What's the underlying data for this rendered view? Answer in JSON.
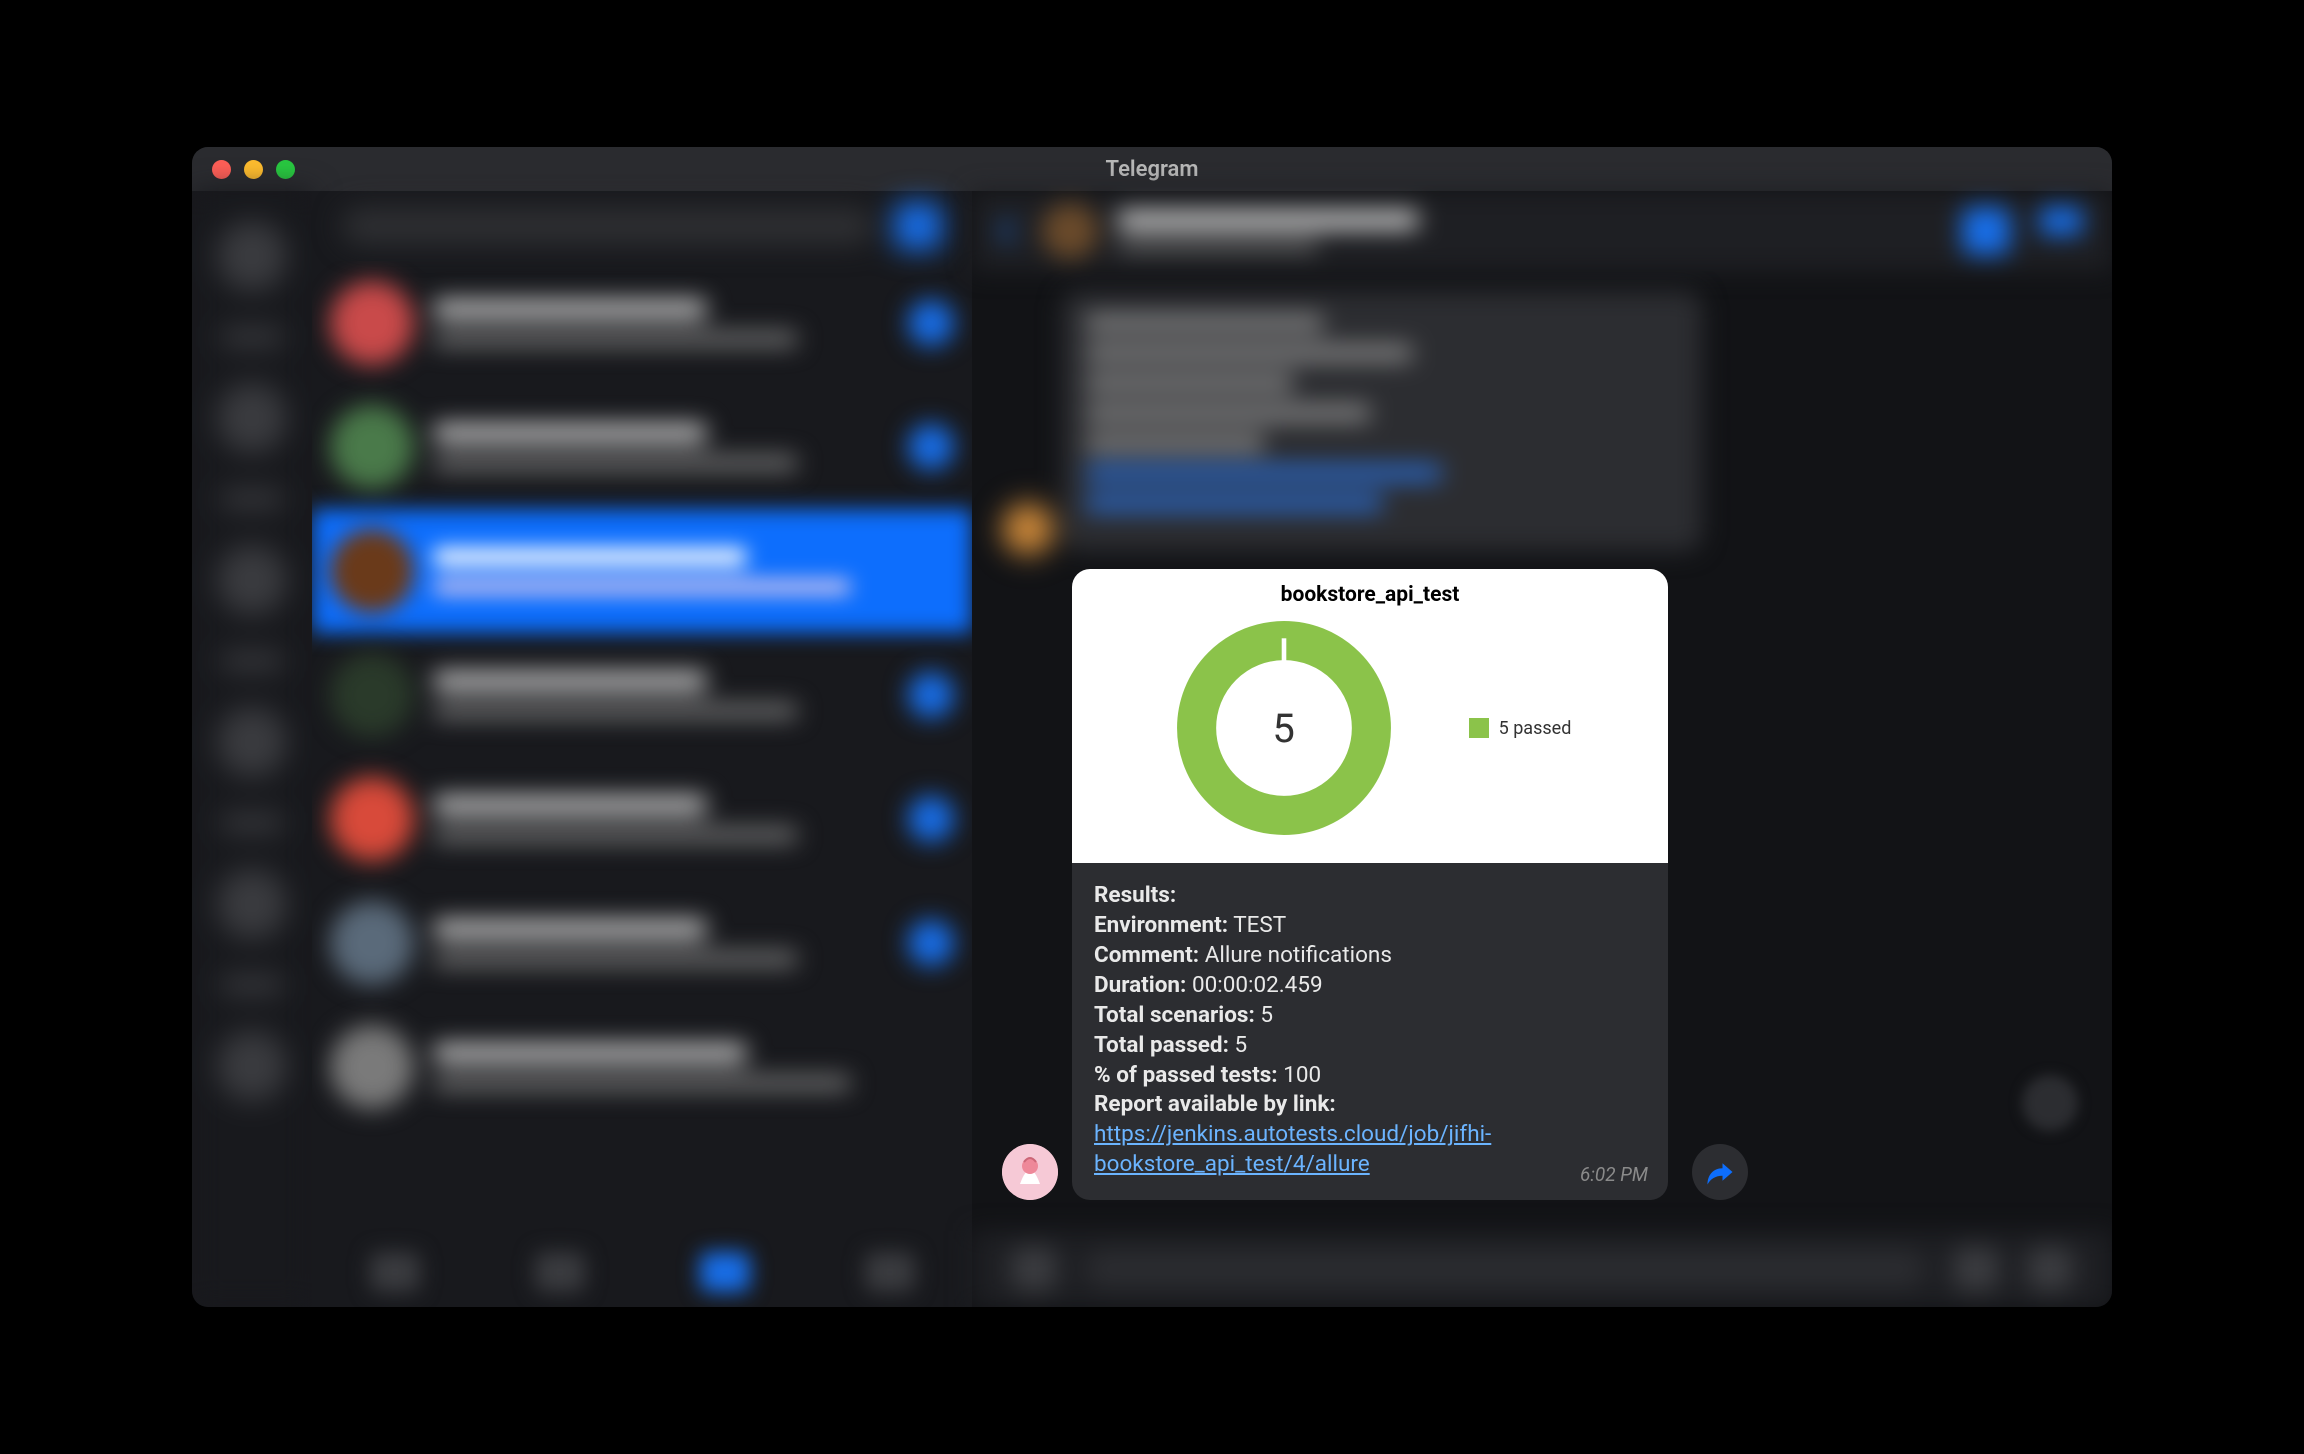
{
  "window": {
    "title": "Telegram"
  },
  "message": {
    "card_title": "bookstore_api_test",
    "donut_value": "5",
    "legend": "5 passed",
    "results_label": "Results:",
    "env_label": "Environment:",
    "env_value": "TEST",
    "comment_label": "Comment:",
    "comment_value": "Allure notifications",
    "duration_label": "Duration:",
    "duration_value": "00:00:02.459",
    "total_label": "Total scenarios:",
    "total_value": "5",
    "passed_label": "Total passed:",
    "passed_value": "5",
    "pct_label": "% of passed tests:",
    "pct_value": "100",
    "link_label": "Report available by link:",
    "link_text": "https://jenkins.autotests.cloud/job/jifhi-bookstore_api_test/4/allure",
    "time": "6:02 PM"
  },
  "chart_data": {
    "type": "pie",
    "title": "bookstore_api_test",
    "series": [
      {
        "name": "passed",
        "value": 5,
        "color": "#8bc34a"
      }
    ],
    "total": 5,
    "center_label": "5",
    "legend": [
      "5 passed"
    ]
  }
}
